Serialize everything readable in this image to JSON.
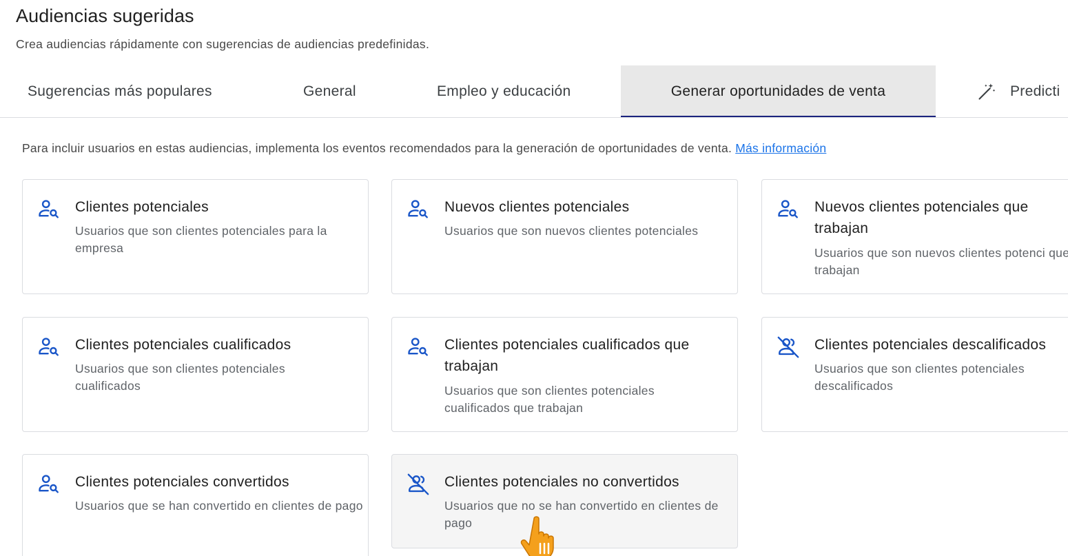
{
  "header": {
    "title": "Audiencias sugeridas",
    "subtitle": "Crea audiencias rápidamente con sugerencias de audiencias predefinidas."
  },
  "tabs": [
    {
      "label": "Sugerencias más populares",
      "active": false
    },
    {
      "label": "General",
      "active": false
    },
    {
      "label": "Empleo y educación",
      "active": false
    },
    {
      "label": "Generar oportunidades de venta",
      "active": true
    },
    {
      "label": "Predicti",
      "active": false,
      "icon": "magic-wand-icon"
    }
  ],
  "info": {
    "text": "Para incluir usuarios en estas audiencias, implementa los eventos recomendados para la generación de oportunidades de venta. ",
    "link": "Más información"
  },
  "cards": [
    {
      "title": "Clientes potenciales",
      "description": "Usuarios que son clientes potenciales para la empresa",
      "icon": "person-search-icon"
    },
    {
      "title": "Nuevos clientes potenciales",
      "description": "Usuarios que son nuevos clientes potenciales",
      "icon": "person-search-icon"
    },
    {
      "title": "Nuevos clientes potenciales que trabajan",
      "description": "Usuarios que son nuevos clientes potenci que trabajan",
      "icon": "person-search-icon"
    },
    {
      "title": "Clientes potenciales cualificados",
      "description": "Usuarios que son clientes potenciales cualificados",
      "icon": "person-search-icon"
    },
    {
      "title": "Clientes potenciales cualificados que trabajan",
      "description": "Usuarios que son clientes potenciales cualificados que trabajan",
      "icon": "person-search-icon"
    },
    {
      "title": "Clientes potenciales descalificados",
      "description": "Usuarios que son clientes potenciales descalificados",
      "icon": "person-off-icon"
    },
    {
      "title": "Clientes potenciales convertidos",
      "description": "Usuarios que se han convertido en clientes de pago",
      "icon": "person-search-icon"
    },
    {
      "title": "Clientes potenciales no convertidos",
      "description": "Usuarios que no se han convertido en clientes de pago",
      "icon": "person-off-icon"
    }
  ],
  "colors": {
    "accent": "#1a73e8",
    "icon": "#1a56c8",
    "active_tab_bg": "#e8e8e8",
    "active_tab_indicator": "#1a237e",
    "cursor": "#f4a01c"
  }
}
